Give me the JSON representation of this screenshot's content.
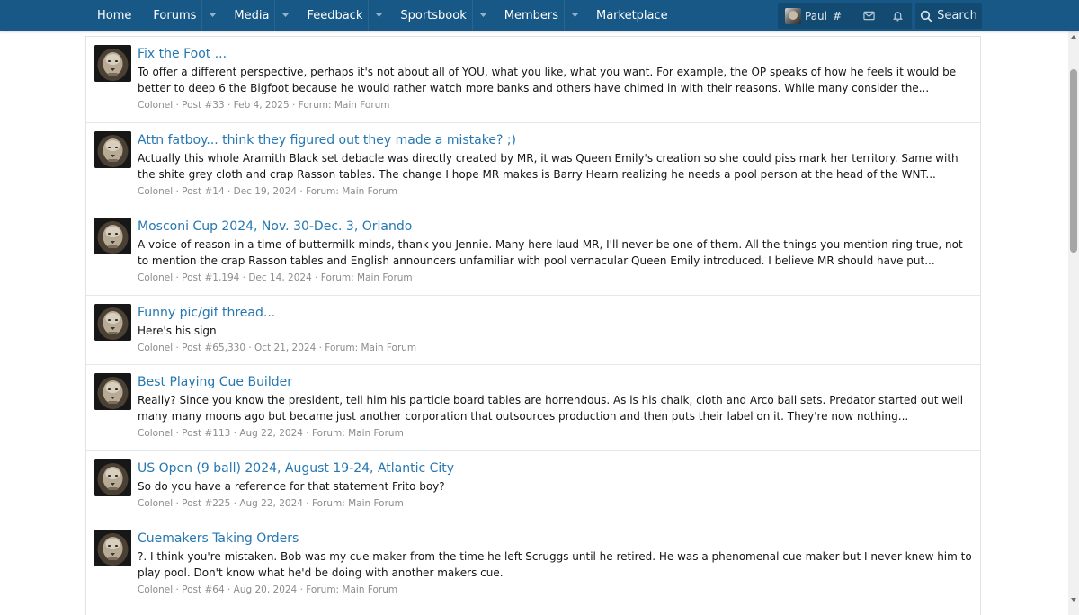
{
  "nav": {
    "items": [
      {
        "label": "Home",
        "dropdown": false
      },
      {
        "label": "Forums",
        "dropdown": true
      },
      {
        "label": "Media",
        "dropdown": true
      },
      {
        "label": "Feedback",
        "dropdown": true
      },
      {
        "label": "Sportsbook",
        "dropdown": true
      },
      {
        "label": "Members",
        "dropdown": true
      },
      {
        "label": "Marketplace",
        "dropdown": false
      }
    ],
    "username": "Paul_#_",
    "search_label": "Search"
  },
  "results": [
    {
      "title": "Fix the Foot ...",
      "snippet": "To offer a different perspective, perhaps it's not about all of YOU, what you like, what you want. For example, the OP speaks of how he feels it would be better to deep 6 the Bigfoot because he would rather watch more banks and others have chimed in with their reasons. While many consider the...",
      "author": "Colonel",
      "post": "Post #33",
      "date": "Feb 4, 2025",
      "forum": "Forum: Main Forum"
    },
    {
      "title": "Attn fatboy... think they figured out they made a mistake? ;)",
      "snippet": "Actually this whole Aramith Black set debacle was directly created by MR, it was Queen Emily's creation so she could piss mark her territory. Same with the shite grey cloth and crap Rasson tables. The change I hope MR makes is Barry Hearn realizing he needs a pool person at the head of the WNT...",
      "author": "Colonel",
      "post": "Post #14",
      "date": "Dec 19, 2024",
      "forum": "Forum: Main Forum"
    },
    {
      "title": "Mosconi Cup 2024, Nov. 30-Dec. 3, Orlando",
      "snippet": "A voice of reason in a time of buttermilk minds, thank you Jennie. Many here laud MR, I'll never be one of them. All the things you mention ring true, not to mention the crap Rasson tables and English announcers unfamiliar with pool vernacular Queen Emily introduced. I believe MR should have put...",
      "author": "Colonel",
      "post": "Post #1,194",
      "date": "Dec 14, 2024",
      "forum": "Forum: Main Forum"
    },
    {
      "title": "Funny pic/gif thread...",
      "snippet": "Here's his sign",
      "author": "Colonel",
      "post": "Post #65,330",
      "date": "Oct 21, 2024",
      "forum": "Forum: Main Forum"
    },
    {
      "title": "Best Playing Cue Builder",
      "snippet": "Really? Since you know the president, tell him his particle board tables are horrendous. As is his chalk, cloth and Arco ball sets. Predator started out well many many moons ago but became just another corporation that outsources production and then puts their label on it. They're now nothing...",
      "author": "Colonel",
      "post": "Post #113",
      "date": "Aug 22, 2024",
      "forum": "Forum: Main Forum"
    },
    {
      "title": "US Open (9 ball) 2024, August 19-24, Atlantic City",
      "snippet": "So do you have a reference for that statement Frito boy?",
      "author": "Colonel",
      "post": "Post #225",
      "date": "Aug 22, 2024",
      "forum": "Forum: Main Forum"
    },
    {
      "title": "Cuemakers Taking Orders",
      "snippet": "?. I think you're mistaken. Bob was my cue maker from the time he left Scruggs until he retired. He was a phenomenal cue maker but I never knew him to play pool. Don't know what he'd be doing with another makers cue.",
      "author": "Colonel",
      "post": "Post #64",
      "date": "Aug 20, 2024",
      "forum": "Forum: Main Forum"
    }
  ],
  "colors": {
    "nav_bg": "#185886",
    "link": "#2577b1",
    "meta": "#8c8c8c"
  }
}
